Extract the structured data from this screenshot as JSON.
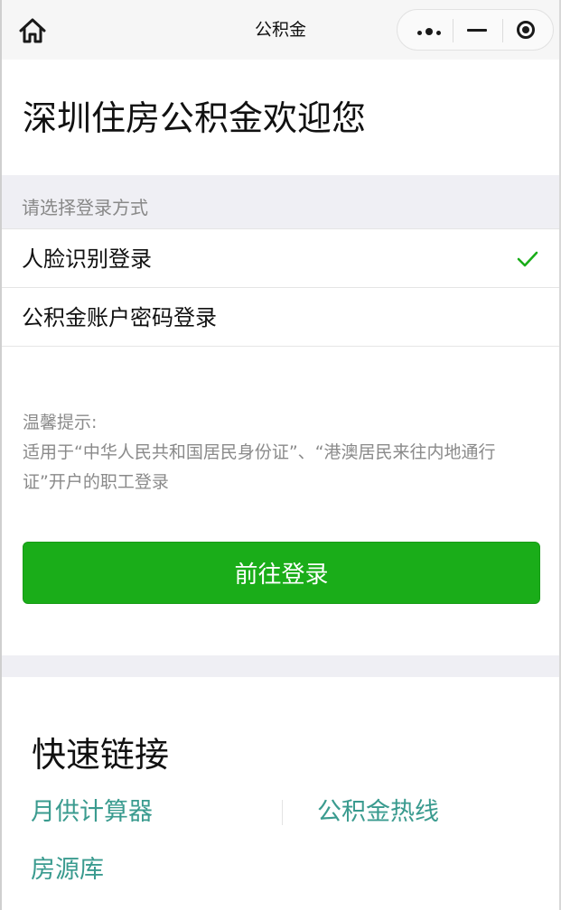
{
  "navbar": {
    "title": "公积金",
    "home_icon": "home-icon",
    "more_icon": "more-dots-icon",
    "minimize_icon": "minimize-icon",
    "close_icon": "target-close-icon"
  },
  "welcome": {
    "title": "深圳住房公积金欢迎您"
  },
  "login": {
    "section_label": "请选择登录方式",
    "options": [
      {
        "label": "人脸识别登录",
        "selected": true
      },
      {
        "label": "公积金账户密码登录",
        "selected": false
      }
    ]
  },
  "tips": {
    "heading": "温馨提示:",
    "body": "适用于“中华人民共和国居民身份证”、“港澳居民来往内地通行证”开户的职工登录"
  },
  "actions": {
    "login_button": "前往登录"
  },
  "quick_links": {
    "title": "快速链接",
    "items": [
      {
        "label": "月供计算器"
      },
      {
        "label": "公积金热线"
      },
      {
        "label": "房源库"
      }
    ]
  },
  "colors": {
    "accent_green": "#1aad19",
    "link_teal": "#3a9b8f",
    "section_bg": "#efeff4"
  }
}
